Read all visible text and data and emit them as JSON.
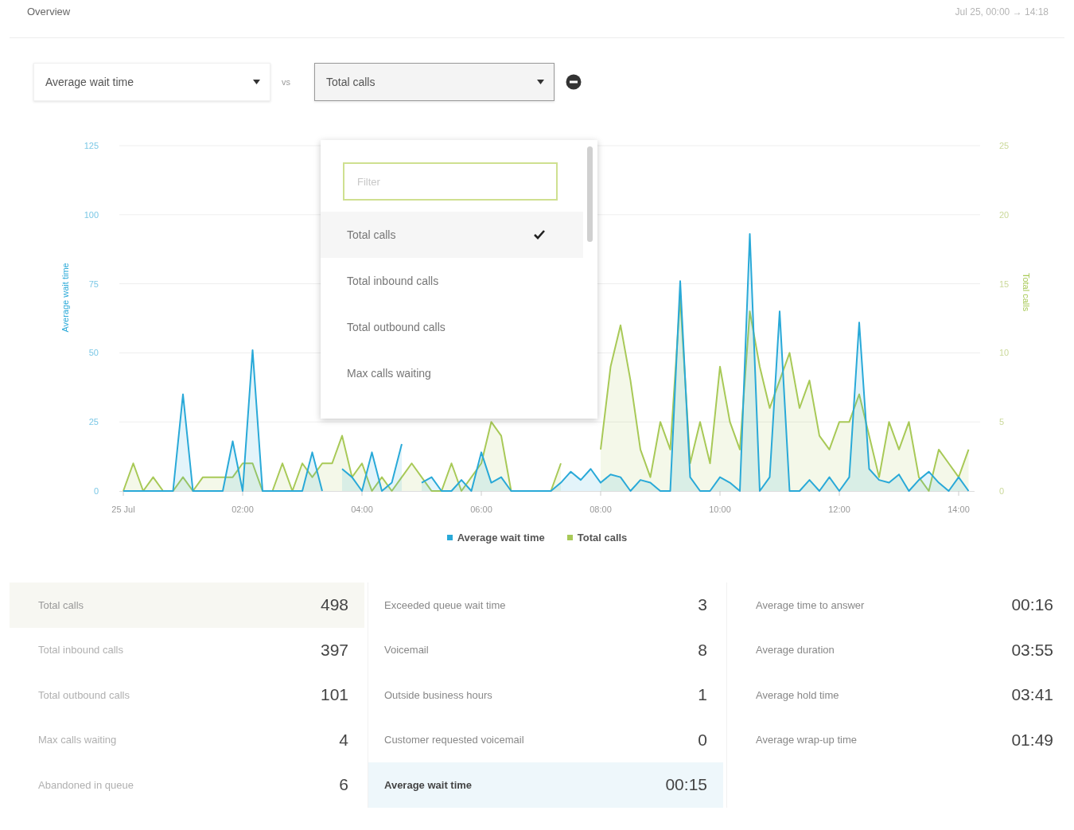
{
  "header": {
    "title": "Overview",
    "range": "Jul 25, 00:00 → 14:18"
  },
  "controls": {
    "primary_metric": "Average wait time",
    "versus": "vs",
    "compare_metric": "Total calls",
    "compare_open": true
  },
  "dropdown": {
    "filter": {
      "placeholder": "Filter"
    },
    "options": [
      {
        "label": "Total calls",
        "selected": true
      },
      {
        "label": "Total inbound calls",
        "selected": false
      },
      {
        "label": "Total outbound calls",
        "selected": false
      },
      {
        "label": "Max calls waiting",
        "selected": false
      }
    ]
  },
  "chart_data": {
    "type": "area",
    "ylabel": "Average wait time",
    "y2label": "Total calls",
    "x": [
      0,
      10,
      20,
      30,
      40,
      50,
      60,
      70,
      80,
      90,
      100,
      110,
      120,
      130,
      140,
      150,
      160,
      170,
      180,
      190,
      200,
      210,
      220,
      230,
      240,
      250,
      260,
      270,
      280,
      290,
      300,
      310,
      320,
      330,
      340,
      350,
      360,
      370,
      380,
      390,
      400,
      410,
      420,
      430,
      440,
      450,
      460,
      470,
      480,
      490,
      500,
      510,
      520,
      530,
      540,
      550,
      560,
      570,
      580,
      590,
      600,
      610,
      620,
      630,
      640,
      650,
      660,
      670,
      680,
      690,
      700,
      710,
      720,
      730,
      740,
      750,
      760,
      770,
      780,
      790,
      800,
      810,
      820,
      830,
      840,
      850
    ],
    "xlim": [
      0,
      858
    ],
    "xticks": [
      {
        "value": 0,
        "label": "25 Jul"
      },
      {
        "value": 120,
        "label": "02:00"
      },
      {
        "value": 240,
        "label": "04:00"
      },
      {
        "value": 360,
        "label": "06:00"
      },
      {
        "value": 480,
        "label": "08:00"
      },
      {
        "value": 600,
        "label": "10:00"
      },
      {
        "value": 720,
        "label": "12:00"
      },
      {
        "value": 840,
        "label": "14:00"
      }
    ],
    "grid": true,
    "ylim": [
      0,
      125
    ],
    "yticks": [
      0,
      25,
      50,
      75,
      100,
      125
    ],
    "y2lim": [
      0,
      25
    ],
    "y2ticks": [
      0,
      5,
      10,
      15,
      20,
      25
    ],
    "series": [
      {
        "name": "Average wait time",
        "color": "#29a9d8",
        "values": [
          0,
          0,
          0,
          0,
          0,
          0,
          35,
          0,
          0,
          0,
          0,
          18,
          0,
          51,
          0,
          0,
          0,
          0,
          0,
          14,
          0,
          null,
          8,
          5,
          0,
          14,
          0,
          3,
          17,
          null,
          3,
          5,
          0,
          0,
          4,
          0,
          14,
          3,
          5,
          0,
          0,
          0,
          0,
          0,
          3,
          7,
          4,
          8,
          3,
          6,
          5,
          0,
          4,
          3,
          0,
          0,
          76,
          5,
          0,
          0,
          5,
          3,
          0,
          93,
          0,
          5,
          65,
          0,
          0,
          4,
          0,
          5,
          0,
          5,
          61,
          8,
          4,
          3,
          6,
          0,
          4,
          7,
          3,
          0,
          5,
          0
        ]
      },
      {
        "name": "Total calls",
        "color": "#a8c957",
        "axis": "y2",
        "values": [
          0,
          2,
          0,
          1,
          0,
          0,
          1,
          0,
          1,
          1,
          1,
          1,
          2,
          2,
          0,
          0,
          2,
          0,
          2,
          1,
          2,
          2,
          4,
          1,
          2,
          0,
          1,
          0,
          1,
          2,
          1,
          0,
          0,
          2,
          0,
          1,
          2,
          5,
          4,
          0,
          0,
          0,
          0,
          0,
          2,
          null,
          null,
          null,
          3,
          9,
          12,
          8,
          3,
          1,
          5,
          3,
          14,
          2,
          5,
          2,
          9,
          5,
          3,
          13,
          9,
          6,
          8,
          10,
          6,
          8,
          4,
          3,
          5,
          5,
          7,
          4,
          1,
          5,
          3,
          5,
          1,
          0,
          3,
          2,
          1,
          3
        ]
      }
    ]
  },
  "stats": [
    [
      {
        "label": "Total calls",
        "value": "498",
        "selected": true,
        "color": "#f7f7f2"
      },
      {
        "label": "Total inbound calls",
        "value": "397",
        "selected": false
      },
      {
        "label": "Total outbound calls",
        "value": "101",
        "selected": false
      },
      {
        "label": "Max calls waiting",
        "value": "4",
        "selected": false
      },
      {
        "label": "Abandoned in queue",
        "value": "6",
        "selected": false
      }
    ],
    [
      {
        "label": "Exceeded queue wait time",
        "value": "3",
        "selected": false
      },
      {
        "label": "Voicemail",
        "value": "8",
        "selected": false
      },
      {
        "label": "Outside business hours",
        "value": "1",
        "selected": false
      },
      {
        "label": "Customer requested voicemail",
        "value": "0",
        "selected": false
      },
      {
        "label": "Average wait time",
        "value": "00:15",
        "selected": true,
        "color": "#eef7fb"
      }
    ],
    [
      {
        "label": "Average time to answer",
        "value": "00:16",
        "selected": false
      },
      {
        "label": "Average duration",
        "value": "03:55",
        "selected": false
      },
      {
        "label": "Average hold time",
        "value": "03:41",
        "selected": false
      },
      {
        "label": "Average wrap-up time",
        "value": "01:49",
        "selected": false
      }
    ]
  ]
}
